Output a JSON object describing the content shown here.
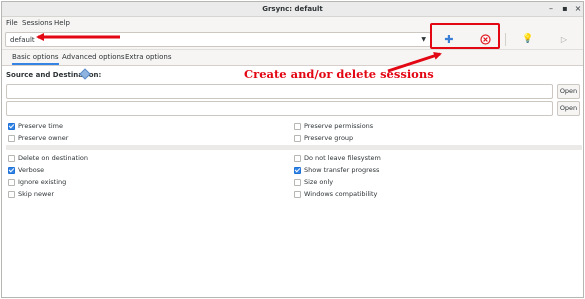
{
  "window": {
    "title": "Grsync: default"
  },
  "menu": [
    "File",
    "Sessions",
    "Help"
  ],
  "toolbar": {
    "session_value": "default"
  },
  "tabs": [
    "Basic options",
    "Advanced options",
    "Extra options"
  ],
  "source": {
    "label": "Source and Destination:",
    "open_label": "Open"
  },
  "options": {
    "preserve_time": {
      "label": "Preserve time",
      "checked": true
    },
    "preserve_permissions": {
      "label": "Preserve permissions",
      "checked": false
    },
    "preserve_owner": {
      "label": "Preserve owner",
      "checked": false
    },
    "preserve_group": {
      "label": "Preserve group",
      "checked": false
    },
    "delete_dest": {
      "label": "Delete on destination",
      "checked": false
    },
    "no_leave_fs": {
      "label": "Do not leave filesystem",
      "checked": false
    },
    "verbose": {
      "label": "Verbose",
      "checked": true
    },
    "show_progress": {
      "label": "Show transfer progress",
      "checked": true
    },
    "ignore_existing": {
      "label": "Ignore existing",
      "checked": false
    },
    "size_only": {
      "label": "Size only",
      "checked": false
    },
    "skip_newer": {
      "label": "Skip newer",
      "checked": false
    },
    "windows_compat": {
      "label": "Windows compatibility",
      "checked": false
    }
  },
  "annotation": {
    "text": "Create and/or delete sessions",
    "color": "#e30613"
  },
  "colors": {
    "accent": "#3584e4",
    "add_icon": "#3b7ed6",
    "delete_icon": "#e01b24"
  }
}
